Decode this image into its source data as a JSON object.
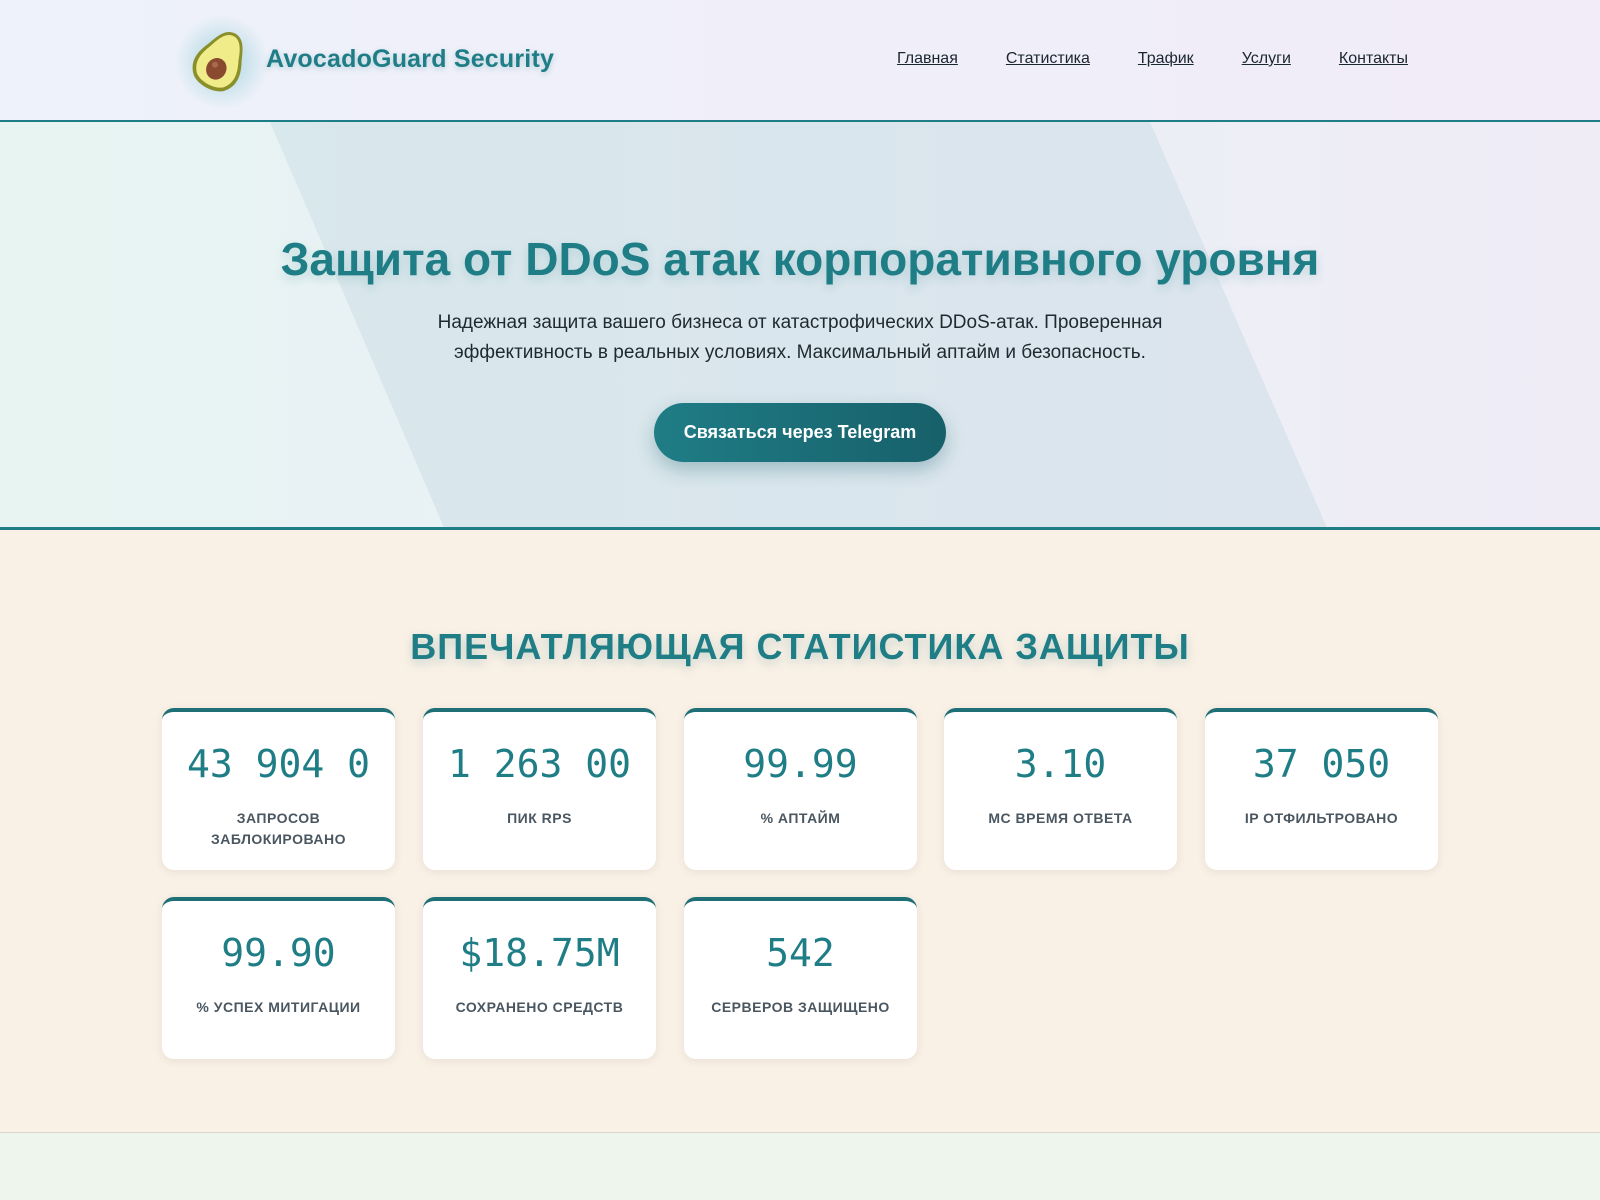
{
  "header": {
    "brand": "AvocadoGuard Security",
    "logo_icon": "avocado-icon",
    "nav": [
      {
        "label": "Главная"
      },
      {
        "label": "Статистика"
      },
      {
        "label": "Трафик"
      },
      {
        "label": "Услуги"
      },
      {
        "label": "Контакты"
      }
    ]
  },
  "hero": {
    "title": "Защита от DDoS атак корпоративного уровня",
    "subtitle": "Надежная защита вашего бизнеса от катастрофических DDoS-атак. Проверенная эффективность в реальных условиях. Максимальный аптайм и безопасность.",
    "cta_label": "Связаться через Telegram"
  },
  "stats": {
    "title": "ВПЕЧАТЛЯЮЩАЯ СТАТИСТИКА ЗАЩИТЫ",
    "cards": [
      {
        "value": "43 904 0",
        "label": "ЗАПРОСОВ ЗАБЛОКИРОВАНО"
      },
      {
        "value": "1 263 00",
        "label": "ПИК RPS"
      },
      {
        "value": "99.99",
        "label": "% АПТАЙМ"
      },
      {
        "value": "3.10",
        "label": "МС ВРЕМЯ ОТВЕТА"
      },
      {
        "value": "37 050",
        "label": "IP ОТФИЛЬТРОВАНО"
      },
      {
        "value": "99.90",
        "label": "% УСПЕХ МИТИГАЦИИ"
      },
      {
        "value": "$18.75M",
        "label": "СОХРАНЕНО СРЕДСТВ"
      },
      {
        "value": "542",
        "label": "СЕРВЕРОВ ЗАЩИЩЕНО"
      }
    ]
  },
  "colors": {
    "accent": "#1f7d86",
    "accent_dark": "#17606a",
    "stats_bg": "#faf1e6"
  }
}
